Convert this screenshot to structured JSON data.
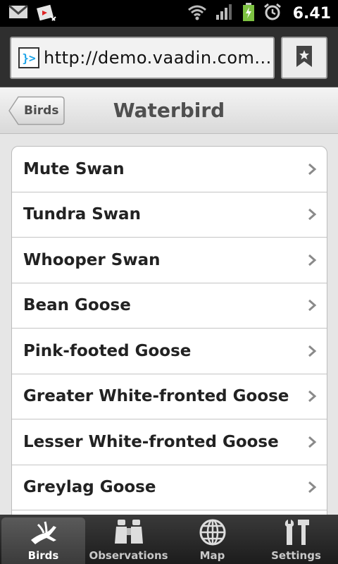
{
  "status_bar": {
    "time": "6.41",
    "icons": [
      "gmail-icon",
      "video-notification-icon",
      "wifi-icon",
      "signal-icon",
      "battery-charging-icon",
      "alarm-icon"
    ]
  },
  "browser": {
    "url": "http://demo.vaadin.com...",
    "favicon_text": "}>",
    "bookmark_icon": "bookmark-icon"
  },
  "nav": {
    "back_label": "Birds",
    "title": "Waterbird"
  },
  "list": {
    "items": [
      {
        "label": "Mute Swan"
      },
      {
        "label": "Tundra Swan"
      },
      {
        "label": "Whooper Swan"
      },
      {
        "label": "Bean Goose"
      },
      {
        "label": "Pink-footed Goose"
      },
      {
        "label": "Greater White-fronted Goose"
      },
      {
        "label": "Lesser White-fronted Goose"
      },
      {
        "label": "Greylag Goose"
      }
    ]
  },
  "tabs": [
    {
      "label": "Birds",
      "icon": "bird-icon",
      "active": true
    },
    {
      "label": "Observations",
      "icon": "binoculars-icon",
      "active": false
    },
    {
      "label": "Map",
      "icon": "globe-icon",
      "active": false
    },
    {
      "label": "Settings",
      "icon": "tools-icon",
      "active": false
    }
  ],
  "colors": {
    "favicon_accent": "#1aa3e8",
    "battery_green": "#7dc242"
  }
}
